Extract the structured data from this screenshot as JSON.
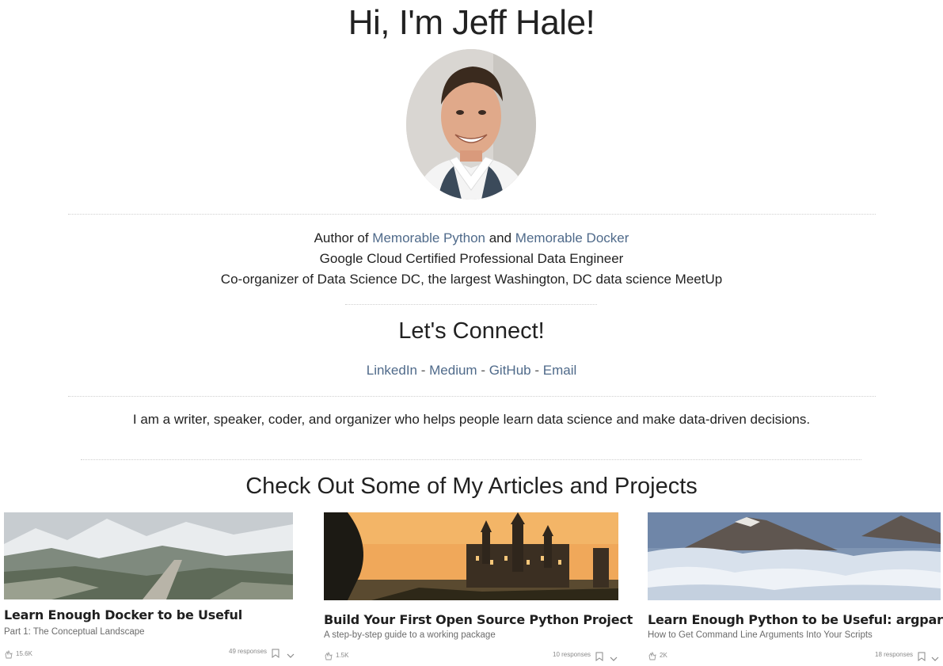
{
  "header": {
    "title": "Hi, I'm Jeff Hale!"
  },
  "bio": {
    "line1_prefix": "Author of ",
    "book1": "Memorable Python",
    "line1_and": " and ",
    "book2": "Memorable Docker",
    "line2": "Google Cloud Certified Professional Data Engineer",
    "line3": "Co-organizer of Data Science DC, the largest Washington, DC data science MeetUp"
  },
  "connect": {
    "heading": "Let's Connect!",
    "links": [
      "LinkedIn",
      "Medium",
      "GitHub",
      "Email"
    ],
    "separator": " - "
  },
  "about": {
    "text": "I am a writer, speaker, coder, and organizer who helps people learn data science and make data-driven decisions."
  },
  "articles": {
    "heading": "Check Out Some of My Articles and Projects",
    "items": [
      {
        "title": "Learn Enough Docker to be Useful",
        "subtitle": "Part 1: The Conceptual Landscape",
        "claps": "15.6K",
        "responses": "49 responses"
      },
      {
        "title": "Build Your First Open Source Python Project",
        "subtitle": "A step-by-step guide to a working package",
        "claps": "1.5K",
        "responses": "10 responses"
      },
      {
        "title": "Learn Enough Python to be Useful: argparse",
        "subtitle": "How to Get Command Line Arguments Into Your Scripts",
        "claps": "2K",
        "responses": "18 responses"
      }
    ]
  },
  "colors": {
    "link": "#4f6a8a",
    "text": "#222222",
    "muted": "#6b6b6b"
  },
  "icons": [
    "avatar-photo",
    "clap-icon",
    "bookmark-icon",
    "chevron-down-icon"
  ]
}
